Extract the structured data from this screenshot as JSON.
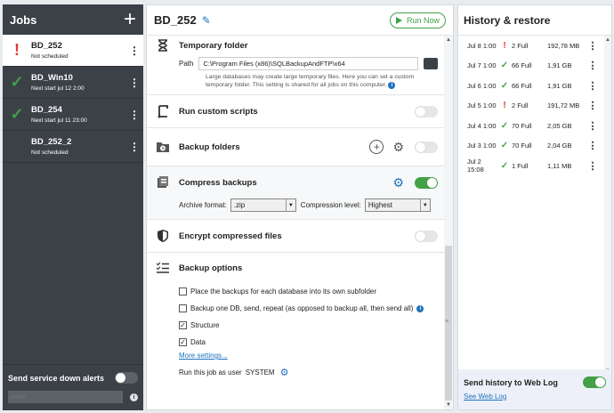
{
  "jobs_panel": {
    "title": "Jobs",
    "jobs": [
      {
        "name": "BD_252",
        "sub": "Not scheduled",
        "status": "warn",
        "selected": true
      },
      {
        "name": "BD_Win10",
        "sub": "Next start jul 12 2:00",
        "status": "ok",
        "selected": false
      },
      {
        "name": "BD_254",
        "sub": "Next start jul 11 23:00",
        "status": "ok",
        "selected": false
      },
      {
        "name": "BD_252_2",
        "sub": "Not scheduled",
        "status": "none",
        "selected": false
      }
    ],
    "alerts_label": "Send service down alerts",
    "email_placeholder": "email"
  },
  "job_detail": {
    "title": "BD_252",
    "run_now": "Run Now",
    "temp_folder": {
      "title": "Temporary folder",
      "path_label": "Path",
      "path_value": "C:\\Program Files (x86)\\SQLBackupAndFTP\\x64",
      "help": "Large databases may create large temporary files. Here you can set a custom temporary folder. This setting is shared for all jobs on this computer."
    },
    "custom_scripts": "Run custom scripts",
    "backup_folders": "Backup folders",
    "compress": {
      "title": "Compress backups",
      "format_label": "Archive format:",
      "format_value": ".zip",
      "level_label": "Compression level:",
      "level_value": "Highest"
    },
    "encrypt": "Encrypt compressed files",
    "backup_options": {
      "title": "Backup options",
      "options": [
        {
          "label": "Place the backups for each database into its own subfolder",
          "checked": false
        },
        {
          "label": "Backup one DB, send, repeat (as opposed to backup all, then send all)",
          "checked": false
        },
        {
          "label": "Structure",
          "checked": true
        },
        {
          "label": "Data",
          "checked": true
        }
      ],
      "more_settings": "More settings...",
      "run_as_label": "Run this job as user",
      "run_as_user": "SYSTEM"
    }
  },
  "history": {
    "title": "History & restore",
    "rows": [
      {
        "date": "Jul 8 1:00",
        "status": "warn",
        "count": "2 Full",
        "size": "192,78 MB"
      },
      {
        "date": "Jul 7 1:00",
        "status": "ok",
        "count": "66 Full",
        "size": "1,91 GB"
      },
      {
        "date": "Jul 6 1:00",
        "status": "ok",
        "count": "66 Full",
        "size": "1,91 GB"
      },
      {
        "date": "Jul 5 1:00",
        "status": "warn",
        "count": "2 Full",
        "size": "191,72 MB"
      },
      {
        "date": "Jul 4 1:00",
        "status": "ok",
        "count": "70 Full",
        "size": "2,05 GB"
      },
      {
        "date": "Jul 3 1:00",
        "status": "ok",
        "count": "70 Full",
        "size": "2,04 GB"
      },
      {
        "date": "Jul 2 15:08",
        "status": "ok",
        "count": "1 Full",
        "size": "1,11 MB"
      }
    ],
    "weblog_label": "Send history to Web Log",
    "see_weblog": "See Web Log"
  },
  "colors": {
    "sidebar_bg": "#3b4147",
    "accent_green": "#43a047",
    "accent_blue": "#1e73be",
    "warn_red": "#e53935"
  },
  "icons": {
    "warn": "exclamation-icon",
    "ok": "checkmark-icon"
  }
}
